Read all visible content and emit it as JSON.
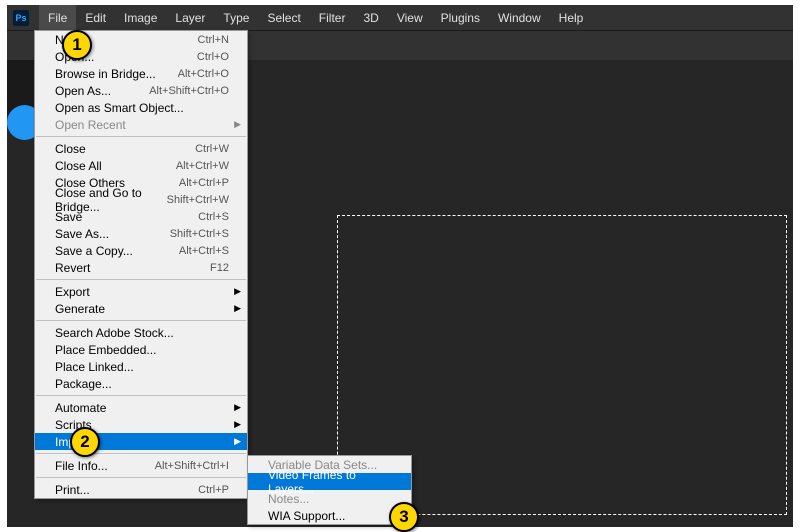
{
  "menubar": {
    "logo": "Ps",
    "items": [
      "File",
      "Edit",
      "Image",
      "Layer",
      "Type",
      "Select",
      "Filter",
      "3D",
      "View",
      "Plugins",
      "Window",
      "Help"
    ],
    "activeIndex": 0
  },
  "fileMenu": {
    "groups": [
      [
        {
          "label": "New...",
          "shortcut": "Ctrl+N"
        },
        {
          "label": "Open...",
          "shortcut": "Ctrl+O"
        },
        {
          "label": "Browse in Bridge...",
          "shortcut": "Alt+Ctrl+O"
        },
        {
          "label": "Open As...",
          "shortcut": "Alt+Shift+Ctrl+O"
        },
        {
          "label": "Open as Smart Object..."
        },
        {
          "label": "Open Recent",
          "submenu": true,
          "disabled": true
        }
      ],
      [
        {
          "label": "Close",
          "shortcut": "Ctrl+W"
        },
        {
          "label": "Close All",
          "shortcut": "Alt+Ctrl+W"
        },
        {
          "label": "Close Others",
          "shortcut": "Alt+Ctrl+P"
        },
        {
          "label": "Close and Go to Bridge...",
          "shortcut": "Shift+Ctrl+W"
        },
        {
          "label": "Save",
          "shortcut": "Ctrl+S"
        },
        {
          "label": "Save As...",
          "shortcut": "Shift+Ctrl+S"
        },
        {
          "label": "Save a Copy...",
          "shortcut": "Alt+Ctrl+S"
        },
        {
          "label": "Revert",
          "shortcut": "F12"
        }
      ],
      [
        {
          "label": "Export",
          "submenu": true
        },
        {
          "label": "Generate",
          "submenu": true
        }
      ],
      [
        {
          "label": "Search Adobe Stock..."
        },
        {
          "label": "Place Embedded..."
        },
        {
          "label": "Place Linked..."
        },
        {
          "label": "Package..."
        }
      ],
      [
        {
          "label": "Automate",
          "submenu": true
        },
        {
          "label": "Scripts",
          "submenu": true
        },
        {
          "label": "Import",
          "submenu": true,
          "highlighted": true
        }
      ],
      [
        {
          "label": "File Info...",
          "shortcut": "Alt+Shift+Ctrl+I"
        }
      ],
      [
        {
          "label": "Print...",
          "shortcut": "Ctrl+P"
        }
      ]
    ]
  },
  "importSubmenu": [
    {
      "label": "Variable Data Sets...",
      "disabled": true
    },
    {
      "label": "Video Frames to Layers...",
      "highlighted": true
    },
    {
      "label": "Notes...",
      "disabled": true
    },
    {
      "label": "WIA Support..."
    }
  ],
  "badges": {
    "b1": "1",
    "b2": "2",
    "b3": "3"
  }
}
